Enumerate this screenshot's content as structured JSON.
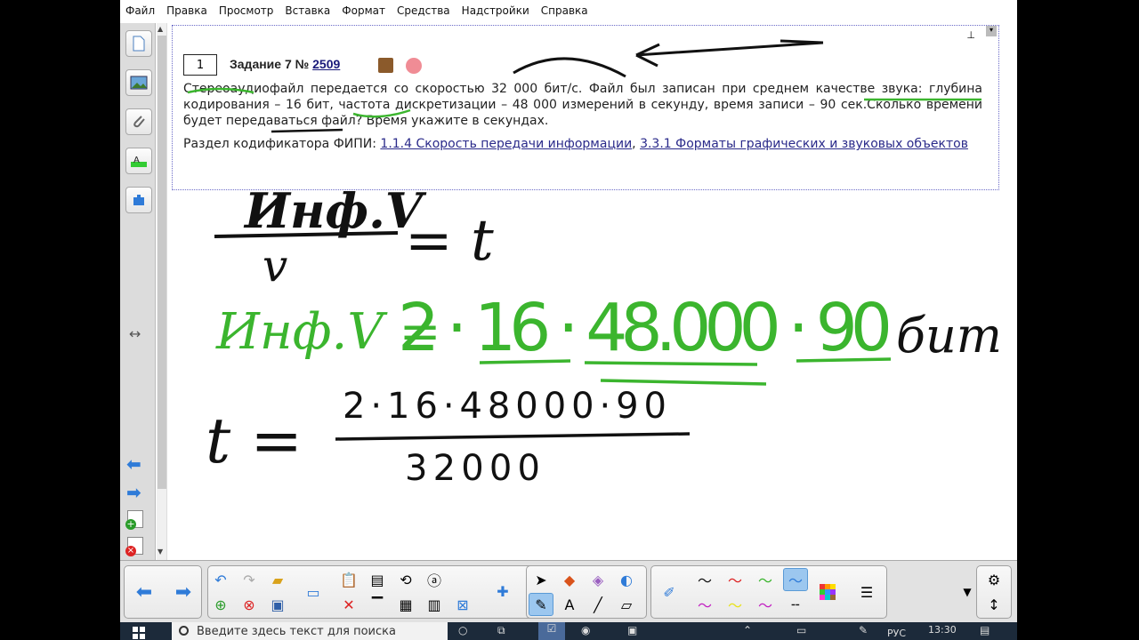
{
  "menu": [
    "Файл",
    "Правка",
    "Просмотр",
    "Вставка",
    "Формат",
    "Средства",
    "Надстройки",
    "Справка"
  ],
  "task": {
    "number": "1",
    "title_prefix": "Задание 7 №",
    "task_link": "2509",
    "text": "Стереоаудиофайл передается со скоростью 32 000 бит/с. Файл был записан при среднем качестве звука: глубина кодирования – 16 бит, частота дискретизации – 48 000 измерений в секунду, время записи – 90 сек.Сколько времени будет передаваться файл? Время укажите в секундах.",
    "codifier_label": "Раздел кодификатора ФИПИ:",
    "codifier_link1": "1.1.4 Скорость передачи информации",
    "codifier_sep": ",",
    "codifier_link2": "3.3.1 Форматы графических и звуковых объектов"
  },
  "ink": {
    "formula1_num": "Инф.V",
    "formula1_den": "v",
    "formula1_rhs": "= t",
    "formula2_lhs": "Инф.V =",
    "formula2_rhs": "2 · 16 · 48.000 · 90",
    "formula2_unit": "бит",
    "formula3_lhs": "t =",
    "formula3_num": "2·16·48000·90",
    "formula3_den": "32000"
  },
  "taskbar": {
    "search_placeholder": "Введите здесь текст для поиска",
    "lang": "РУС",
    "time": "13:30"
  },
  "colors": {
    "ink_black": "#111111",
    "ink_green": "#3bb52e",
    "link": "#2a2a8a",
    "accent_blue": "#2f7bd8"
  }
}
